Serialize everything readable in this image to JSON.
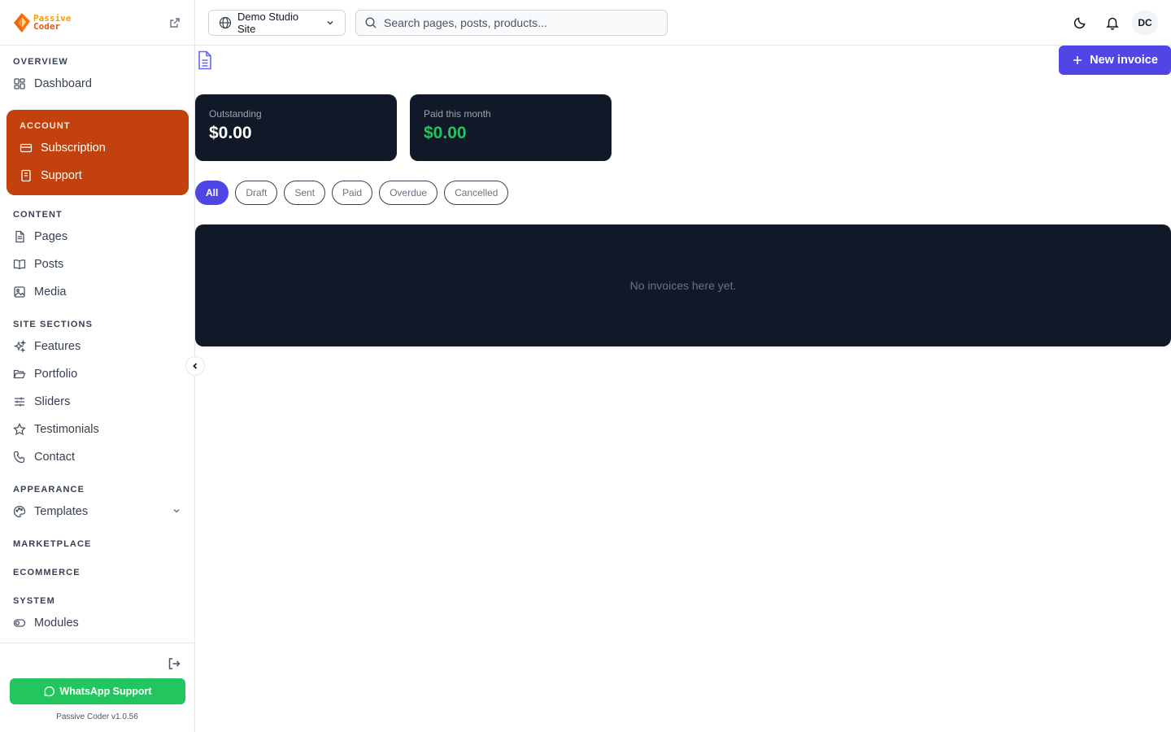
{
  "brand": {
    "line1": "Passive",
    "line2": "Coder"
  },
  "sidebar": {
    "sections": {
      "overview": "OVERVIEW",
      "account": "ACCOUNT",
      "content": "CONTENT",
      "site_sections": "SITE SECTIONS",
      "appearance": "APPEARANCE",
      "marketplace": "MARKETPLACE",
      "ecommerce": "ECOMMERCE",
      "system": "SYSTEM"
    },
    "items": {
      "dashboard": "Dashboard",
      "subscription": "Subscription",
      "support": "Support",
      "pages": "Pages",
      "posts": "Posts",
      "media": "Media",
      "features": "Features",
      "portfolio": "Portfolio",
      "sliders": "Sliders",
      "testimonials": "Testimonials",
      "contact": "Contact",
      "templates": "Templates",
      "modules": "Modules"
    },
    "whatsapp_label": "WhatsApp Support",
    "version": "Passive Coder v1.0.56"
  },
  "topbar": {
    "site_name": "Demo Studio Site",
    "search_placeholder": "Search pages, posts, products...",
    "avatar_initials": "DC"
  },
  "main": {
    "new_invoice_label": "New invoice",
    "cards": {
      "outstanding_label": "Outstanding",
      "outstanding_value": "$0.00",
      "paid_label": "Paid this month",
      "paid_value": "$0.00"
    },
    "filters": [
      "All",
      "Draft",
      "Sent",
      "Paid",
      "Overdue",
      "Cancelled"
    ],
    "active_filter": "All",
    "empty_message": "No invoices here yet."
  },
  "colors": {
    "accent": "#4f46e5",
    "account_bg": "#c2410c",
    "card_bg": "#111827",
    "success": "#22c55e"
  }
}
